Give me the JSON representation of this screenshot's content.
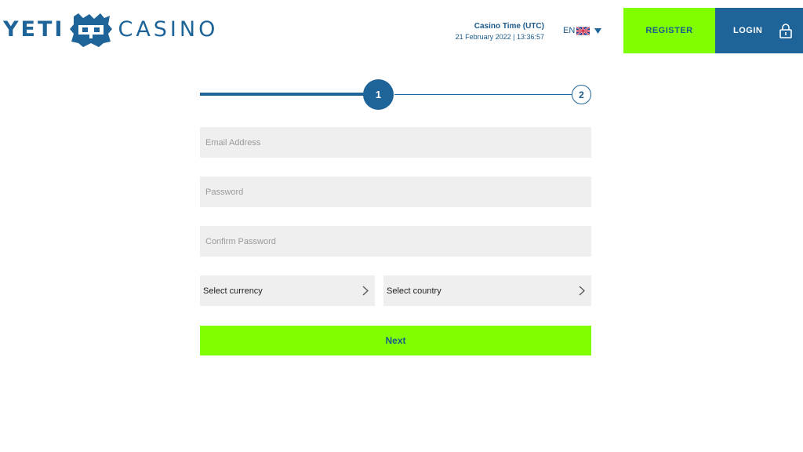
{
  "header": {
    "logo_left": "YETI",
    "logo_right": "CASINO",
    "casino_time_label": "Casino Time (UTC)",
    "casino_time_value": "21 February 2022 | 13:36:57",
    "language_code": "EN",
    "register_label": "REGISTER",
    "login_label": "LOGIN"
  },
  "stepper": {
    "step1": "1",
    "step2": "2",
    "current_step": 1
  },
  "form": {
    "email_placeholder": "Email Address",
    "password_placeholder": "Password",
    "confirm_password_placeholder": "Confirm Password",
    "currency_label": "Select currency",
    "country_label": "Select country",
    "next_label": "Next"
  },
  "colors": {
    "brand_blue": "#1e6498",
    "accent_green": "#7fff00",
    "field_bg": "#efefef"
  },
  "icons": [
    "yeti-face-icon",
    "uk-flag-icon",
    "caret-down-icon",
    "lock-icon",
    "chevron-right-icon"
  ]
}
